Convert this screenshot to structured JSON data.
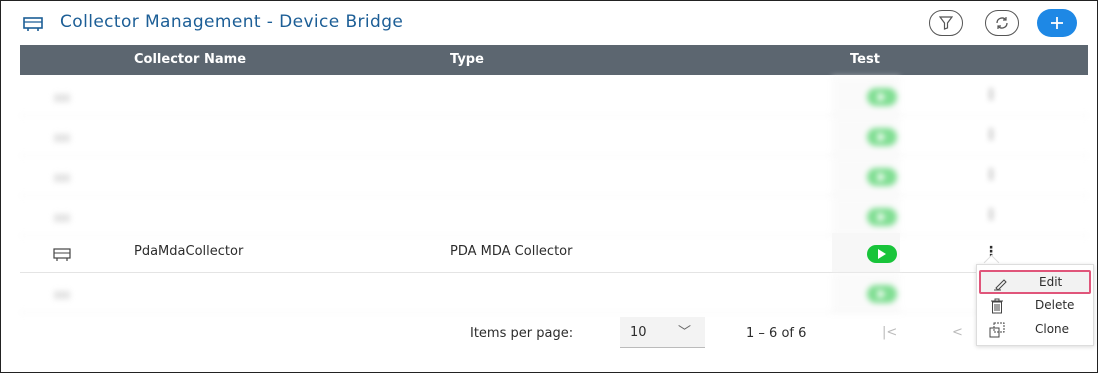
{
  "header": {
    "title": "Collector Management - Device Bridge",
    "icons": [
      "device-bridge-icon",
      "filter-icon",
      "refresh-icon",
      "add-icon"
    ],
    "accent_color": "#1e88e5"
  },
  "table": {
    "columns": [
      "Collector Name",
      "Type",
      "Test"
    ],
    "rows": [
      {
        "name": "",
        "type": "",
        "blurred": true
      },
      {
        "name": "",
        "type": "",
        "blurred": true
      },
      {
        "name": "",
        "type": "",
        "blurred": true
      },
      {
        "name": "",
        "type": "",
        "blurred": true
      },
      {
        "name": "PdaMdaCollector",
        "type": "PDA MDA Collector",
        "blurred": false
      },
      {
        "name": "",
        "type": "",
        "blurred": true
      }
    ],
    "play_color": "#18c43a"
  },
  "pagination": {
    "items_per_page_label": "Items per page:",
    "items_per_page_value": "10",
    "range": "1 – 6 of 6",
    "first_glyph": "|<",
    "prev_glyph": "<"
  },
  "context_menu": {
    "items": [
      {
        "label": "Edit",
        "icon": "pencil-icon"
      },
      {
        "label": "Delete",
        "icon": "trash-icon"
      },
      {
        "label": "Clone",
        "icon": "clone-icon"
      }
    ],
    "highlight_color": "#e0557a"
  }
}
